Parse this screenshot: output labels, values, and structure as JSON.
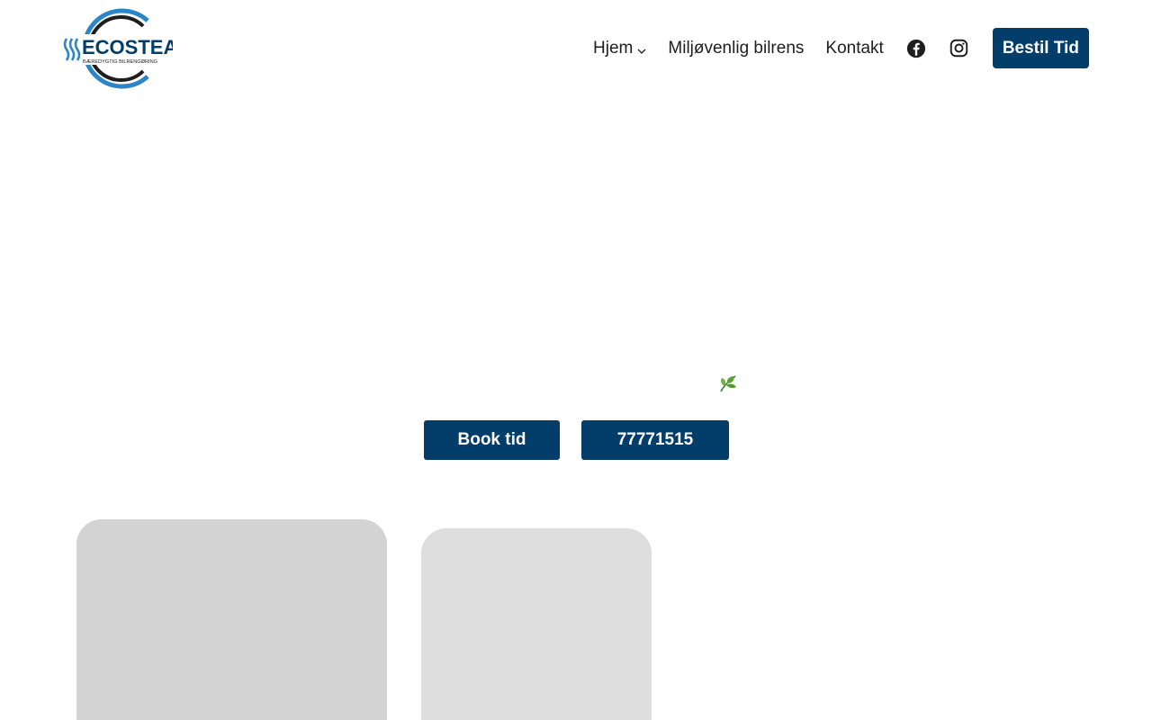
{
  "brand": {
    "name": "ECOSTEAM",
    "tagline": "BÆREDYGTIG BILRENGØRING",
    "colors": {
      "navy": "#033e6b",
      "blue": "#2b85c6",
      "dark": "#1e1e1e"
    }
  },
  "nav": {
    "items": [
      {
        "label": "Hjem",
        "has_dropdown": true,
        "icon": "chevron-down-icon"
      },
      {
        "label": "Miljøvenlig bilrens"
      },
      {
        "label": "Kontakt"
      }
    ],
    "social": [
      {
        "icon": "facebook-icon"
      },
      {
        "icon": "instagram-icon"
      }
    ],
    "cta_label": "Bestil Tid"
  },
  "hero": {
    "leaf_icon": "leaf-icon",
    "book_label": "Book tid",
    "phone_label": "77771515"
  },
  "colors": {
    "card_one": "#d3d3d3",
    "card_two": "#dedede"
  }
}
